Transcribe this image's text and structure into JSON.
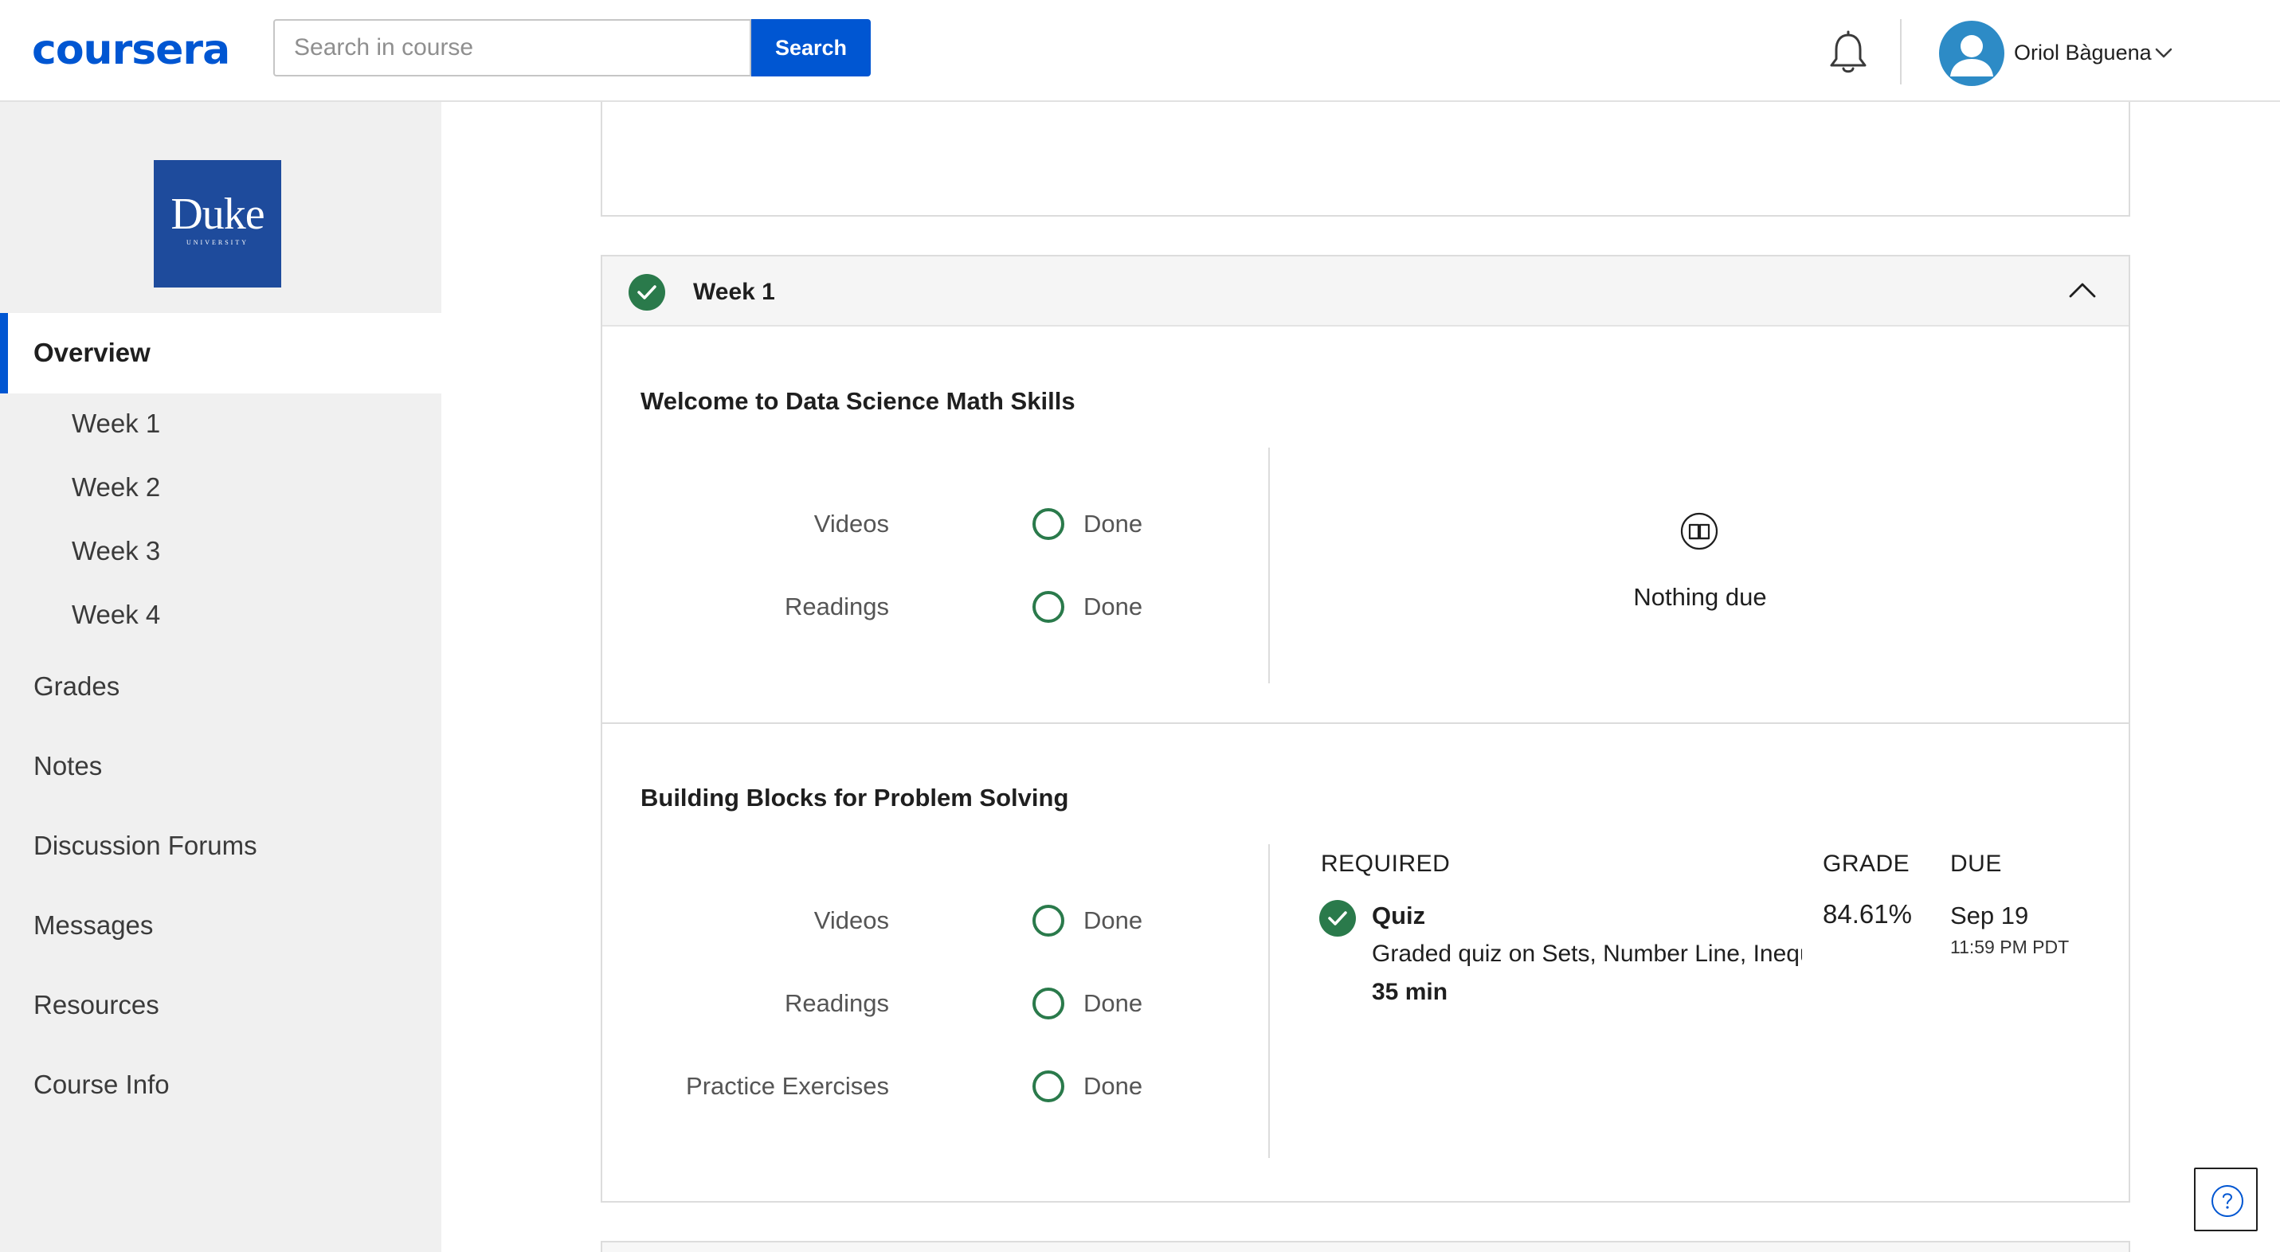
{
  "header": {
    "logo_text": "coursera",
    "search_placeholder": "Search in course",
    "search_button": "Search",
    "user_name": "Oriol Bàguena"
  },
  "sidebar": {
    "school_logo": {
      "word": "Duke",
      "sub": "UNIVERSITY"
    },
    "active_item": "Overview",
    "week_items": [
      "Week 1",
      "Week 2",
      "Week 3",
      "Week 4"
    ],
    "items": [
      "Grades",
      "Notes",
      "Discussion Forums",
      "Messages",
      "Resources",
      "Course Info"
    ]
  },
  "week": {
    "title": "Week 1",
    "completed": true,
    "sections": [
      {
        "title": "Welcome to Data Science Math Skills",
        "progress": [
          {
            "label": "Videos",
            "status": "Done"
          },
          {
            "label": "Readings",
            "status": "Done"
          }
        ],
        "nothing_due": "Nothing due"
      },
      {
        "title": "Building Blocks for Problem Solving",
        "progress": [
          {
            "label": "Videos",
            "status": "Done"
          },
          {
            "label": "Readings",
            "status": "Done"
          },
          {
            "label": "Practice Exercises",
            "status": "Done"
          }
        ],
        "columns": {
          "required": "REQUIRED",
          "grade": "GRADE",
          "due": "DUE"
        },
        "assignment": {
          "type": "Quiz",
          "description": "Graded quiz on Sets, Number Line, Inequalities",
          "duration": "35 min",
          "grade": "84.61%",
          "due_date": "Sep 19",
          "due_time": "11:59 PM PDT",
          "completed": true
        }
      }
    ]
  },
  "colors": {
    "brand_blue": "#0056d2",
    "success_green": "#2a7a4b",
    "sidebar_bg": "#f0f0f0",
    "duke_blue": "#1e4b9c"
  },
  "icons": [
    "bell-icon",
    "user-avatar-icon",
    "chevron-down-icon",
    "check-circle-icon",
    "chevron-up-icon",
    "progress-ring-icon",
    "book-icon",
    "help-icon"
  ]
}
